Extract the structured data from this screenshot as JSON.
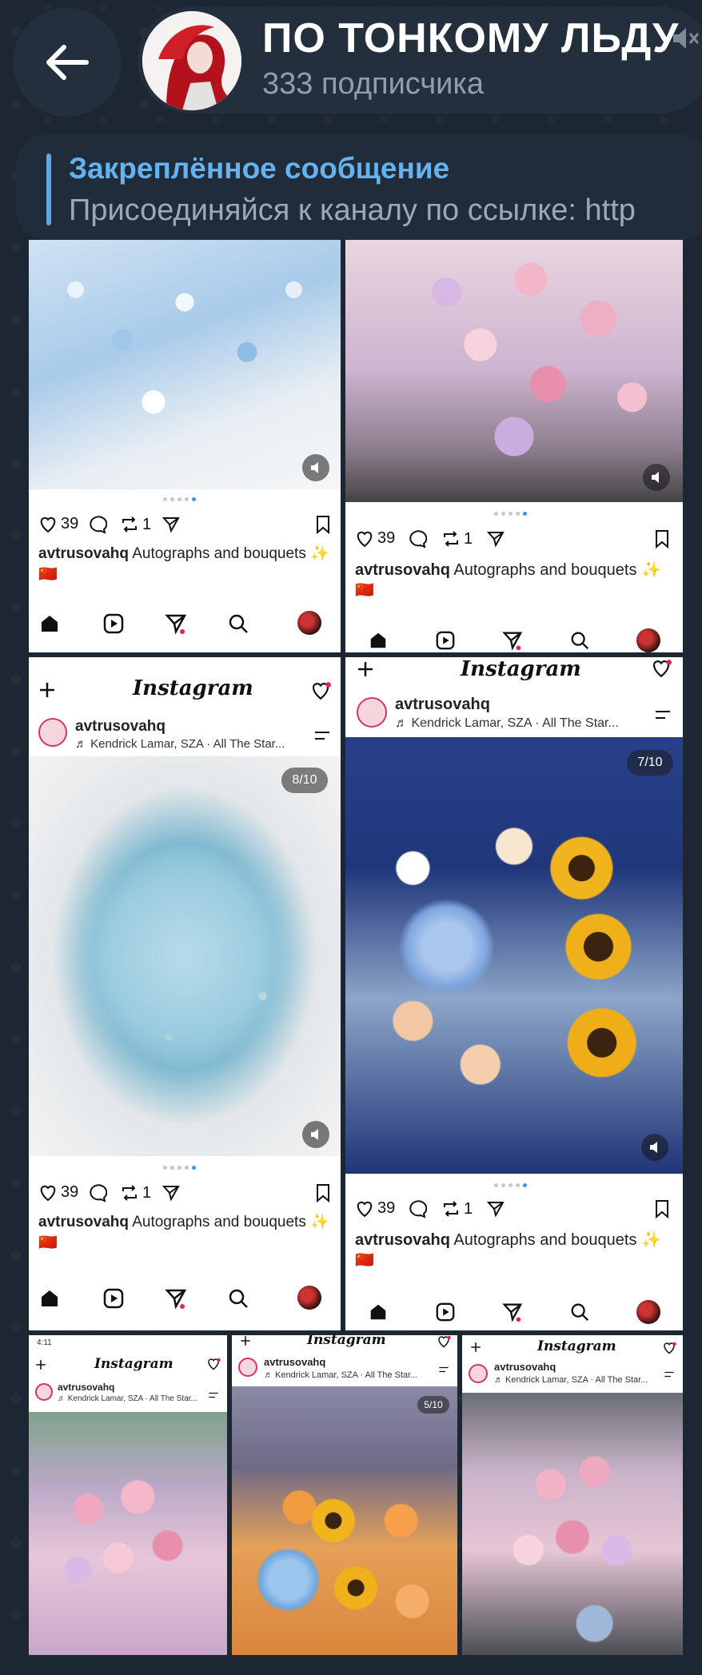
{
  "header": {
    "back_label": "back",
    "title": "ПО ТОНКОМУ ЛЬДУ",
    "subtitle": "333 подписчика"
  },
  "pinned": {
    "title": "Закреплённое сообщение",
    "text": "Присоединяйся к каналу по ссылке: http"
  },
  "posts": [
    {
      "likes": "39",
      "reposts": "1",
      "username": "avtrusovahq",
      "caption": "Autographs and bouquets ✨",
      "flag": "🇨🇳"
    },
    {
      "likes": "39",
      "reposts": "1",
      "username": "avtrusovahq",
      "caption": "Autographs and bouquets ✨",
      "flag": "🇨🇳"
    },
    {
      "logo": "Instagram",
      "username": "avtrusovahq",
      "music": "♬ Kendrick Lamar, SZA · All The Star...",
      "counter": "8/10",
      "likes": "39",
      "reposts": "1",
      "caption": "Autographs and bouquets ✨",
      "flag": "🇨🇳"
    },
    {
      "logo": "Instagram",
      "username": "avtrusovahq",
      "music": "♬ Kendrick Lamar, SZA · All The Star...",
      "counter": "7/10",
      "likes": "39",
      "reposts": "1",
      "caption": "Autographs and bouquets ✨",
      "flag": "🇨🇳"
    },
    {
      "status_time": "4:11",
      "logo": "Instagram",
      "username": "avtrusovahq",
      "music": "♬ Kendrick Lamar, SZA · All The Star..."
    },
    {
      "logo": "Instagram",
      "username": "avtrusovahq",
      "music": "♬ Kendrick Lamar, SZA · All The Star...",
      "counter": "5/10"
    },
    {
      "logo": "Instagram",
      "username": "avtrusovahq",
      "music": "♬ Kendrick Lamar, SZA · All The Star..."
    }
  ],
  "colors": {
    "accent": "#64b3f0",
    "background": "#1c2733",
    "header_bg": "#24303e"
  }
}
